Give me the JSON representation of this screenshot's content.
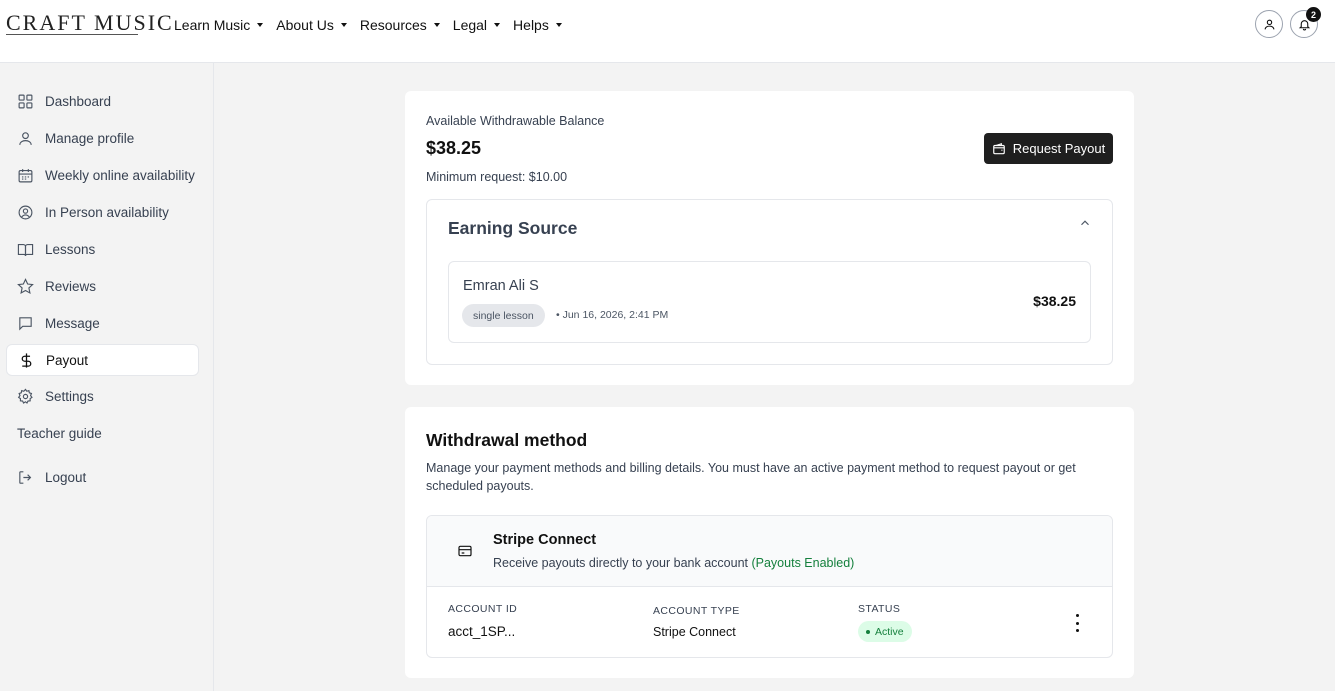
{
  "brand": {
    "logo_text": "CRAFT MUSIC"
  },
  "nav": {
    "items": [
      {
        "label": "Learn Music"
      },
      {
        "label": "About Us"
      },
      {
        "label": "Resources"
      },
      {
        "label": "Legal"
      },
      {
        "label": "Helps"
      }
    ],
    "notification_count": "2"
  },
  "sidebar": {
    "items": [
      {
        "label": "Dashboard",
        "icon": "dashboard-icon"
      },
      {
        "label": "Manage profile",
        "icon": "user-icon"
      },
      {
        "label": "Weekly online availability",
        "icon": "calendar-icon"
      },
      {
        "label": "In Person availability",
        "icon": "user-location-icon"
      },
      {
        "label": "Lessons",
        "icon": "book-icon"
      },
      {
        "label": "Reviews",
        "icon": "star-icon"
      },
      {
        "label": "Message",
        "icon": "message-icon"
      },
      {
        "label": "Payout",
        "icon": "dollar-icon",
        "active": true
      },
      {
        "label": "Settings",
        "icon": "gear-icon"
      },
      {
        "label": "Teacher guide"
      },
      {
        "label": "Logout",
        "icon": "logout-icon"
      }
    ]
  },
  "balance": {
    "label": "Available Withdrawable Balance",
    "amount": "$38.25",
    "min_request": "Minimum request: $10.00",
    "button_label": "Request Payout"
  },
  "earning_source": {
    "title": "Earning Source",
    "entries": [
      {
        "name": "Emran Ali S",
        "type": "single lesson",
        "date": "• Jun 16, 2026, 2:41 PM",
        "amount": "$38.25"
      }
    ]
  },
  "withdrawal": {
    "title": "Withdrawal method",
    "description": "Manage your payment methods and billing details. You must have an active payment method to request payout or get scheduled payouts.",
    "method": {
      "name": "Stripe Connect",
      "subtitle": "Receive payouts directly to your bank account",
      "subtitle_status": "(Payouts Enabled)",
      "account_id_label": "ACCOUNT ID",
      "account_id": "acct_1SP...",
      "account_type_label": "ACCOUNT TYPE",
      "account_type": "Stripe Connect",
      "status_label": "STATUS",
      "status": "Active"
    }
  },
  "colors": {
    "primary_button": "#1f1f1f",
    "success": "#15803d",
    "success_bg": "#dcfce7",
    "page_bg": "#f3f3f3"
  }
}
